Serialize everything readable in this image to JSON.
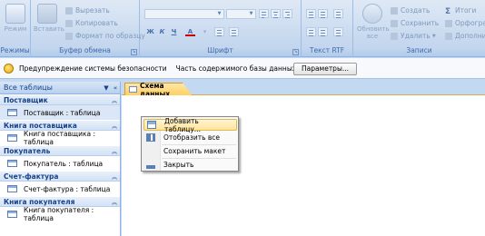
{
  "ribbon": {
    "groups": {
      "views": {
        "label": "Режимы",
        "button": "Режим"
      },
      "clipboard": {
        "label": "Буфер обмена",
        "paste": "Вставить",
        "cut": "Вырезать",
        "copy": "Копировать",
        "format_painter": "Формат по образцу"
      },
      "font": {
        "label": "Шрифт"
      },
      "rich_text": {
        "label": "Текст RTF"
      },
      "records": {
        "label": "Записи",
        "refresh": "Обновить все",
        "new": "Создать",
        "save": "Сохранить",
        "delete": "Удалить",
        "totals": "Итоги",
        "spelling": "Орфогра",
        "more": "Дополни"
      }
    }
  },
  "security_bar": {
    "title": "Предупреждение системы безопасности",
    "message": "Часть содержимого базы данных отключено",
    "button": "Параметры..."
  },
  "nav_pane": {
    "header": "Все таблицы",
    "groups": [
      {
        "title": "Поставщик",
        "item": "Поставщик : таблица"
      },
      {
        "title": "Книга поставщика",
        "item": "Книга поставщика : таблица"
      },
      {
        "title": "Покупатель",
        "item": "Покупатель : таблица"
      },
      {
        "title": "Счет-фактура",
        "item": "Счет-фактура : таблица"
      },
      {
        "title": "Книга покупателя",
        "item": "Книга покупателя : таблица"
      }
    ]
  },
  "document": {
    "tab": "Схема данных"
  },
  "context_menu": {
    "items": [
      "Добавить таблицу...",
      "Отобразить все",
      "Сохранить макет",
      "Закрыть"
    ]
  },
  "colors": {
    "ribbon": "#c7d9ef",
    "tab_active": "#ffcf62",
    "menu_highlight": "#ffe49a"
  }
}
